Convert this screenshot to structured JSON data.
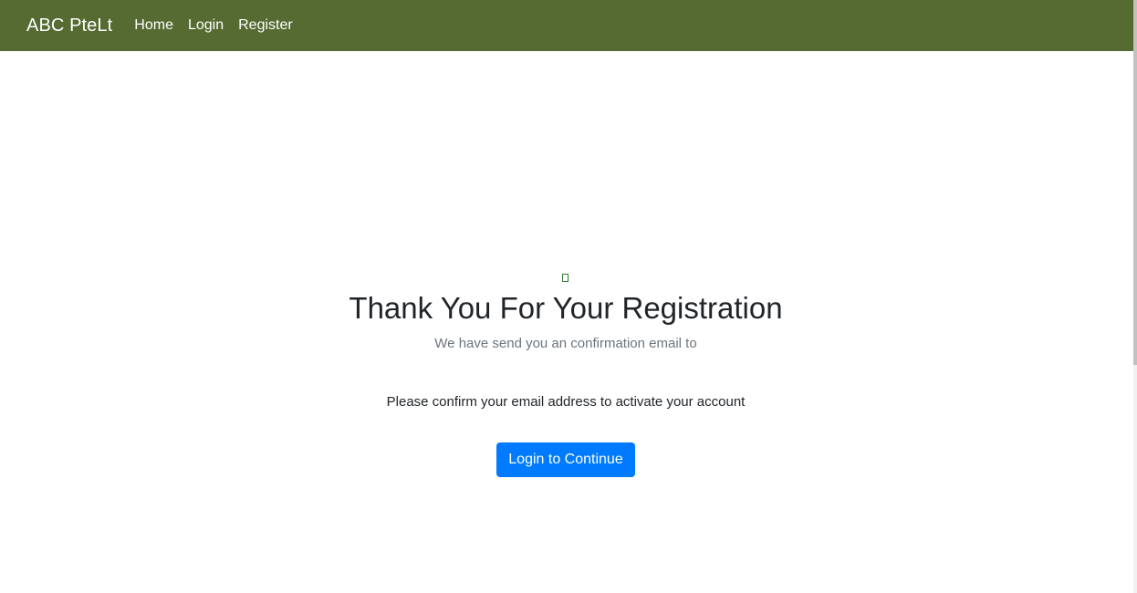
{
  "navbar": {
    "brand": "ABC PteLt",
    "links": [
      "Home",
      "Login",
      "Register"
    ]
  },
  "main": {
    "title": "Thank You For Your Registration",
    "subtitle": "We have send you an confirmation email to",
    "instruction": "Please confirm your email address to activate your account",
    "button_label": "Login to Continue"
  },
  "colors": {
    "navbar_bg": "#566b31",
    "button_bg": "#007bff"
  },
  "icons": {
    "status": "check-icon"
  }
}
